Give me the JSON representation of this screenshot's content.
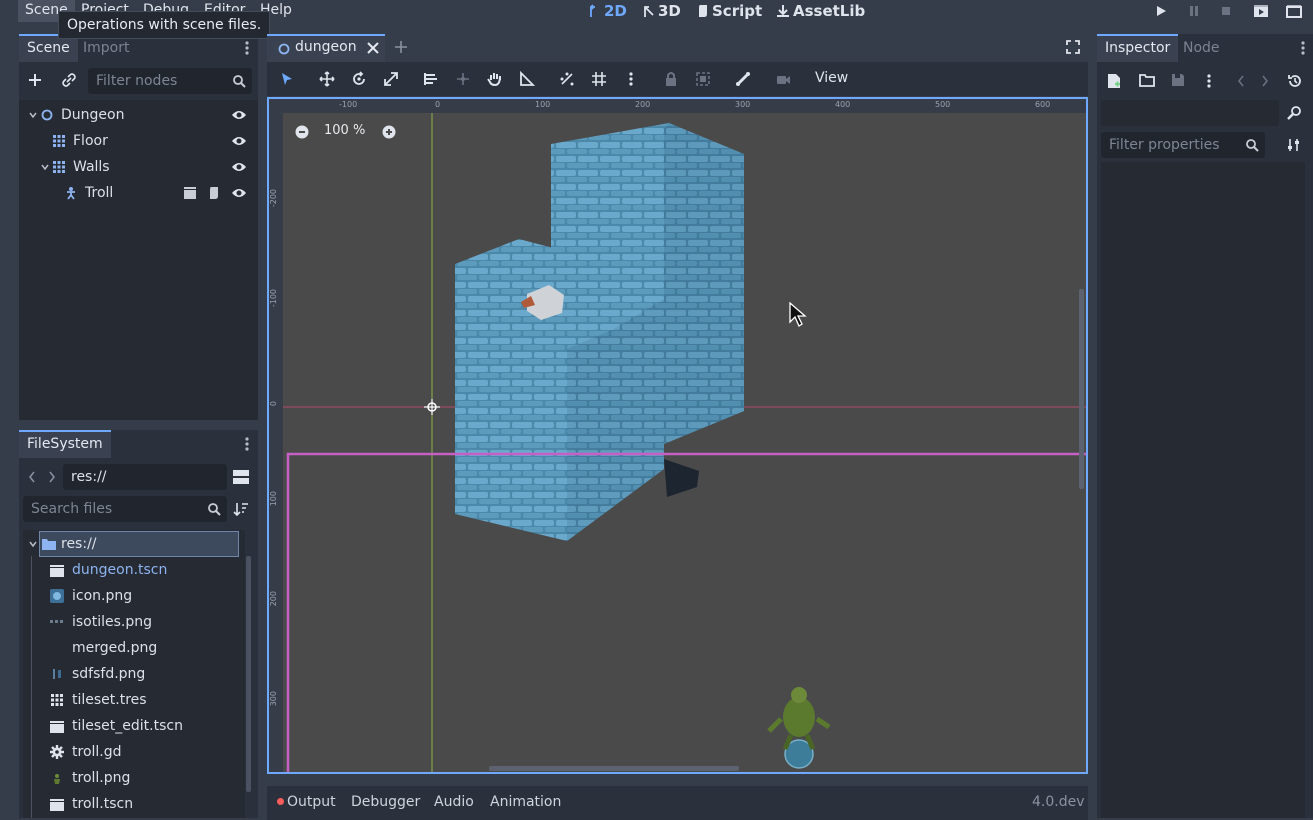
{
  "menu": {
    "scene": "Scene",
    "project": "Project",
    "debug": "Debug",
    "editor": "Editor",
    "help": "Help"
  },
  "main_tabs": {
    "t2d": "2D",
    "t3d": "3D",
    "script": "Script",
    "assetlib": "AssetLib"
  },
  "tooltip": "Operations with scene files.",
  "scene_dock": {
    "tab_scene": "Scene",
    "tab_import": "Import",
    "filter_placeholder": "Filter nodes",
    "nodes": [
      {
        "label": "Dungeon"
      },
      {
        "label": "Floor"
      },
      {
        "label": "Walls"
      },
      {
        "label": "Troll"
      }
    ]
  },
  "filesystem": {
    "tab": "FileSystem",
    "path": "res://",
    "search_placeholder": "Search files",
    "root": "res://",
    "files": [
      {
        "label": "dungeon.tscn"
      },
      {
        "label": "icon.png"
      },
      {
        "label": "isotiles.png"
      },
      {
        "label": "merged.png"
      },
      {
        "label": "sdfsfd.png"
      },
      {
        "label": "tileset.tres"
      },
      {
        "label": "tileset_edit.tscn"
      },
      {
        "label": "troll.gd"
      },
      {
        "label": "troll.png"
      },
      {
        "label": "troll.tscn"
      }
    ]
  },
  "editor_tab": {
    "label": "dungeon"
  },
  "toolbar2d": {
    "view": "View"
  },
  "viewport": {
    "zoom": "100 %",
    "ruler_h": [
      "-100",
      "0",
      "100",
      "200",
      "300",
      "400",
      "500",
      "600"
    ],
    "ruler_v": [
      "-200",
      "-100",
      "0",
      "100",
      "200",
      "300"
    ]
  },
  "inspector": {
    "tab_inspector": "Inspector",
    "tab_node": "Node",
    "filter_placeholder": "Filter properties"
  },
  "bottom_panel": {
    "output": "Output",
    "debugger": "Debugger",
    "audio": "Audio",
    "animation": "Animation",
    "version": "4.0.dev"
  },
  "colors": {
    "accent": "#6fa8ff",
    "tile_blue": "#5d9bbd",
    "bounds_magenta": "#c660c6"
  }
}
